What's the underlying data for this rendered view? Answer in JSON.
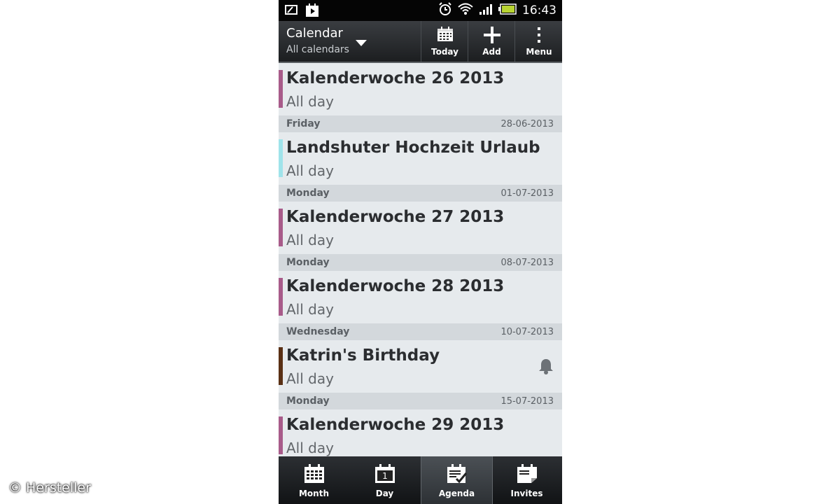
{
  "statusbar": {
    "time": "16:43"
  },
  "actionbar": {
    "title": "Calendar",
    "subtitle": "All calendars",
    "buttons": [
      "Today",
      "Add",
      "Menu"
    ]
  },
  "agenda": [
    {
      "title": "Kalenderwoche 26 2013",
      "sub": "All day",
      "color": "#a85b8a"
    },
    {
      "day": "Friday",
      "date": "28-06-2013"
    },
    {
      "title": "Landshuter Hochzeit Urlaub",
      "sub": "All day",
      "color": "#9fe3ea"
    },
    {
      "day": "Monday",
      "date": "01-07-2013"
    },
    {
      "title": "Kalenderwoche 27 2013",
      "sub": "All day",
      "color": "#a85b8a"
    },
    {
      "day": "Monday",
      "date": "08-07-2013"
    },
    {
      "title": "Kalenderwoche 28 2013",
      "sub": "All day",
      "color": "#a85b8a"
    },
    {
      "day": "Wednesday",
      "date": "10-07-2013"
    },
    {
      "title": "Katrin's Birthday",
      "sub": "All day",
      "color": "#5a3015",
      "reminder": true
    },
    {
      "day": "Monday",
      "date": "15-07-2013"
    },
    {
      "title": "Kalenderwoche 29 2013",
      "sub": "All day",
      "color": "#a85b8a"
    }
  ],
  "tabs": [
    "Month",
    "Day",
    "Agenda",
    "Invites"
  ],
  "active_tab": "Agenda",
  "day_icon_number": "1",
  "credit": "© Hersteller"
}
